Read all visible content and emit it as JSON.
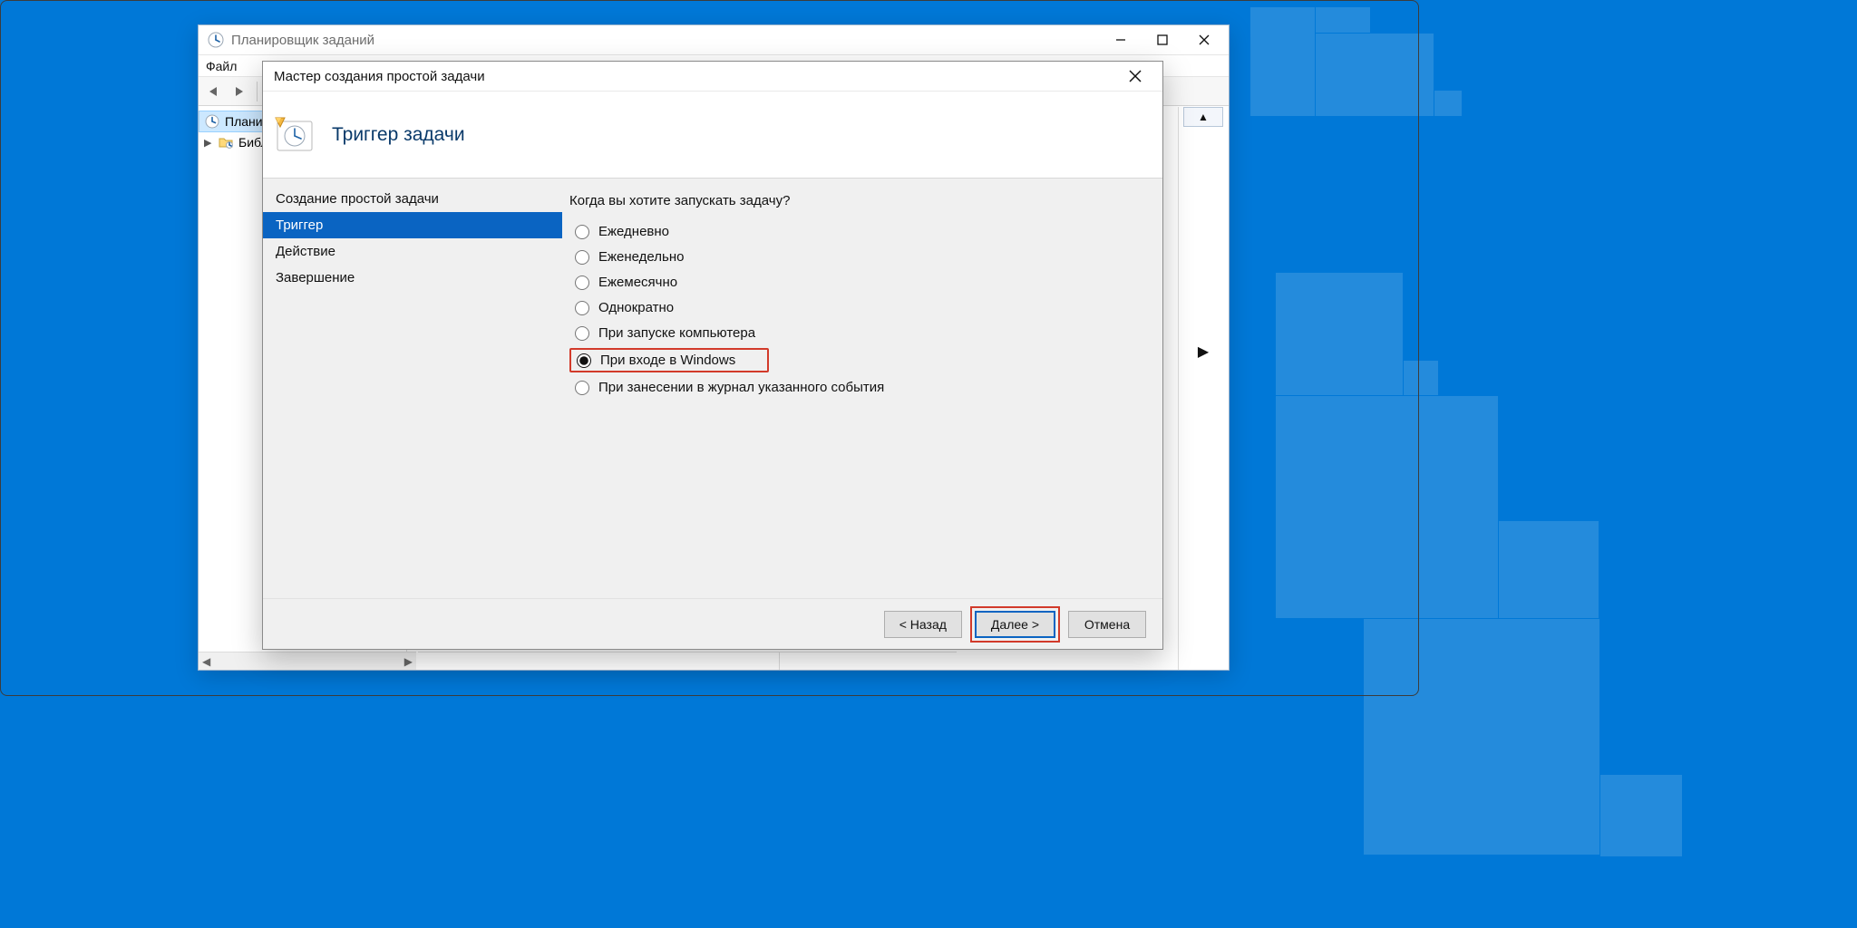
{
  "parent": {
    "title": "Планировщик заданий",
    "menu_file": "Файл",
    "tree": {
      "root": "Планировщик заданий",
      "lib": "Библиотека планировщика"
    }
  },
  "wizard": {
    "title": "Мастер создания простой задачи",
    "heading": "Триггер задачи",
    "steps": {
      "create": "Создание простой задачи",
      "trigger": "Триггер",
      "action": "Действие",
      "finish": "Завершение"
    },
    "prompt": "Когда вы хотите запускать задачу?",
    "options": {
      "daily": "Ежедневно",
      "weekly": "Еженедельно",
      "monthly": "Ежемесячно",
      "once": "Однократно",
      "startup": "При запуске компьютера",
      "logon": "При входе в Windows",
      "onevent": "При занесении в журнал указанного события"
    },
    "buttons": {
      "back": "< Назад",
      "next": "Далее >",
      "cancel": "Отмена"
    }
  }
}
